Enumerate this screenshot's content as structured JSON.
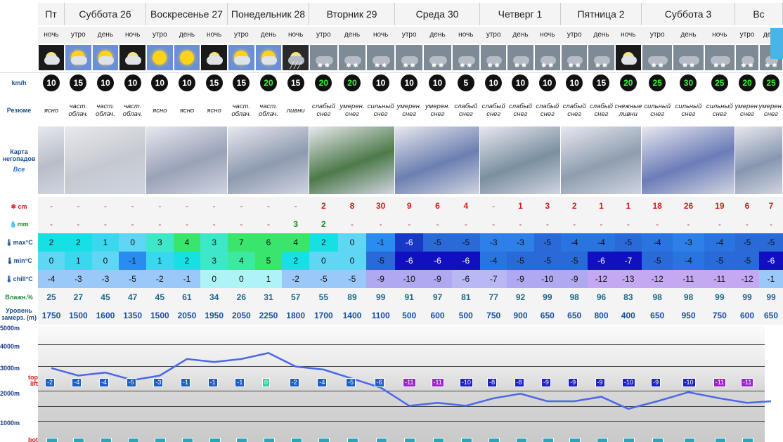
{
  "days": [
    {
      "label": "Пт",
      "cols": 1
    },
    {
      "label": "Суббота 26",
      "cols": 3
    },
    {
      "label": "Воскресенье 27",
      "cols": 3
    },
    {
      "label": "Понедельник 28",
      "cols": 3
    },
    {
      "label": "Вторник 29",
      "cols": 3
    },
    {
      "label": "Среда 30",
      "cols": 3
    },
    {
      "label": "Четверг 1",
      "cols": 3
    },
    {
      "label": "Пятница 2",
      "cols": 3
    },
    {
      "label": "Суббота 3",
      "cols": 3
    },
    {
      "label": "Вс",
      "cols": 2
    }
  ],
  "labels": {
    "wind": "km/h",
    "summary": "Резюме",
    "map1": "Карта",
    "map2": "негопадов",
    "map_all": "Все",
    "snow": "cm",
    "rain": "mm",
    "tmax": "max°C",
    "tmin": "min°C",
    "chill": "chill°C",
    "humidity": "Влажн.%",
    "freezing1": "Уровень",
    "freezing2": "замерз. (m)",
    "top1": "top",
    "top2": "lift",
    "bot": "bot"
  },
  "periods": [
    "ночь",
    "утро",
    "день",
    "ночь",
    "утро",
    "день",
    "ночь",
    "утро",
    "день",
    "ночь",
    "утро",
    "день",
    "ночь",
    "утро",
    "день",
    "ночь",
    "утро",
    "день",
    "ночь",
    "утро",
    "день",
    "ночь",
    "утро",
    "день",
    "ночь",
    "утро",
    "день"
  ],
  "icons": [
    "moon-partly",
    "sun-cloud",
    "sun-cloud",
    "moon-cloud",
    "sun",
    "sun",
    "moon-partly",
    "sun-cloud",
    "sun-cloud",
    "moon-rain",
    "snow-cloud",
    "snow-cloud",
    "snow-cloud",
    "snow-cloud",
    "snow-cloud",
    "snow-cloud",
    "snow-cloud",
    "snow-cloud",
    "snow-cloud",
    "snow-cloud",
    "snow-cloud",
    "moon-partly",
    "snow-cloud",
    "snow-cloud",
    "snow-cloud",
    "snow-cloud",
    "snow-cloud"
  ],
  "wind": [
    "10",
    "15",
    "10",
    "10",
    "10",
    "10",
    "15",
    "15",
    "20",
    "15",
    "20",
    "20",
    "10",
    "10",
    "10",
    "5",
    "10",
    "10",
    "10",
    "10",
    "15",
    "20",
    "25",
    "30",
    "25",
    "20",
    "25"
  ],
  "wind_green": [
    false,
    false,
    false,
    false,
    false,
    false,
    false,
    false,
    true,
    false,
    true,
    true,
    false,
    false,
    false,
    false,
    false,
    false,
    false,
    false,
    false,
    true,
    true,
    true,
    true,
    true,
    true
  ],
  "summary": [
    "ясно",
    "част. облач.",
    "част. облач.",
    "част. облач.",
    "ясно",
    "ясно",
    "ясно",
    "част. облач.",
    "част. облач.",
    "ливни",
    "слабый снег",
    "умерен. снег",
    "сильный снег",
    "умерен. снег",
    "умерен. снег",
    "слабый снег",
    "слабый снег",
    "слабый снег",
    "слабый снег",
    "слабый снег",
    "слабый снег",
    "снежные ливни",
    "сильный снег",
    "сильный снег",
    "сильный снег",
    "умерен. снег",
    "умерен. снег"
  ],
  "snow": [
    "-",
    "-",
    "-",
    "-",
    "-",
    "-",
    "-",
    "-",
    "-",
    "-",
    "2",
    "8",
    "30",
    "9",
    "6",
    "4",
    "-",
    "1",
    "3",
    "2",
    "1",
    "1",
    "18",
    "26",
    "19",
    "6",
    "7"
  ],
  "rain": [
    "-",
    "-",
    "-",
    "-",
    "-",
    "-",
    "-",
    "-",
    "-",
    "3",
    "2",
    "-",
    "-",
    "-",
    "-",
    "-",
    "-",
    "-",
    "-",
    "-",
    "-",
    "-",
    "-",
    "-",
    "-",
    "-",
    "-"
  ],
  "tmax": [
    "2",
    "2",
    "1",
    "0",
    "3",
    "4",
    "3",
    "7",
    "6",
    "4",
    "2",
    "0",
    "-1",
    "-6",
    "-5",
    "-5",
    "-3",
    "-3",
    "-5",
    "-4",
    "-4",
    "-5",
    "-4",
    "-3",
    "-4",
    "-5",
    "-5"
  ],
  "tmin": [
    "0",
    "1",
    "0",
    "-1",
    "1",
    "2",
    "3",
    "4",
    "5",
    "2",
    "0",
    "0",
    "-5",
    "-6",
    "-6",
    "-6",
    "-4",
    "-5",
    "-5",
    "-5",
    "-6",
    "-7",
    "-5",
    "-4",
    "-5",
    "-5",
    "-6"
  ],
  "chill": [
    "-4",
    "-3",
    "-3",
    "-5",
    "-2",
    "-1",
    "0",
    "0",
    "1",
    "-2",
    "-5",
    "-5",
    "-9",
    "-10",
    "-9",
    "-6",
    "-7",
    "-9",
    "-10",
    "-9",
    "-12",
    "-13",
    "-12",
    "-11",
    "-11",
    "-12",
    "-1"
  ],
  "humidity": [
    "25",
    "27",
    "45",
    "47",
    "45",
    "61",
    "34",
    "26",
    "31",
    "57",
    "55",
    "89",
    "99",
    "91",
    "97",
    "81",
    "77",
    "92",
    "99",
    "98",
    "96",
    "83",
    "98",
    "98",
    "99",
    "99",
    "99"
  ],
  "freezing": [
    "1750",
    "1500",
    "1600",
    "1350",
    "1500",
    "2050",
    "1950",
    "2050",
    "2250",
    "1800",
    "1700",
    "1400",
    "1100",
    "500",
    "600",
    "500",
    "750",
    "900",
    "650",
    "650",
    "800",
    "400",
    "650",
    "950",
    "750",
    "600",
    "650"
  ],
  "altitudes": [
    "5000m",
    "4000m",
    "3000m",
    "2000m",
    "1000m"
  ],
  "top_levels": [
    "-2",
    "-4",
    "-4",
    "-5",
    "-3",
    "-1",
    "-1",
    "-1",
    "0",
    "-2",
    "-4",
    "-5",
    "-6",
    "-11",
    "-11",
    "-10",
    "-8",
    "-8",
    "-9",
    "-9",
    "-9",
    "-10",
    "-9",
    "-10",
    "-11",
    "-11"
  ]
}
